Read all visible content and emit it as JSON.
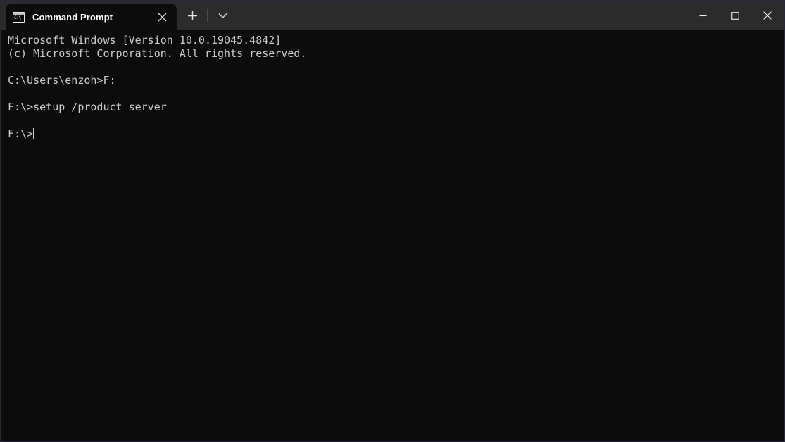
{
  "window": {
    "app": "Windows Terminal",
    "title": "Command Prompt",
    "controls": {
      "minimize_label": "Minimize",
      "maximize_label": "Maximize",
      "close_label": "Close"
    }
  },
  "tabbar": {
    "tabs": [
      {
        "label": "Command Prompt",
        "icon": "command-prompt-icon",
        "icon_glyph": "C:\\_",
        "active": true,
        "close_label": "Close tab"
      }
    ],
    "new_tab_label": "+",
    "dropdown_label": "Open new tab dropdown"
  },
  "terminal": {
    "background": "#0c0c0c",
    "foreground": "#cccccc",
    "lines": [
      "Microsoft Windows [Version 10.0.19045.4842]",
      "(c) Microsoft Corporation. All rights reserved.",
      "",
      "C:\\Users\\enzoh>F:",
      "",
      "F:\\>setup /product server",
      ""
    ],
    "prompt": "F:\\>",
    "cursor_visible": true
  },
  "colors": {
    "titlebar": "#2b2b2b",
    "tab_active": "#0c0c0c",
    "terminal_bg": "#0c0c0c",
    "text": "#cccccc",
    "window_border": "#272736"
  }
}
